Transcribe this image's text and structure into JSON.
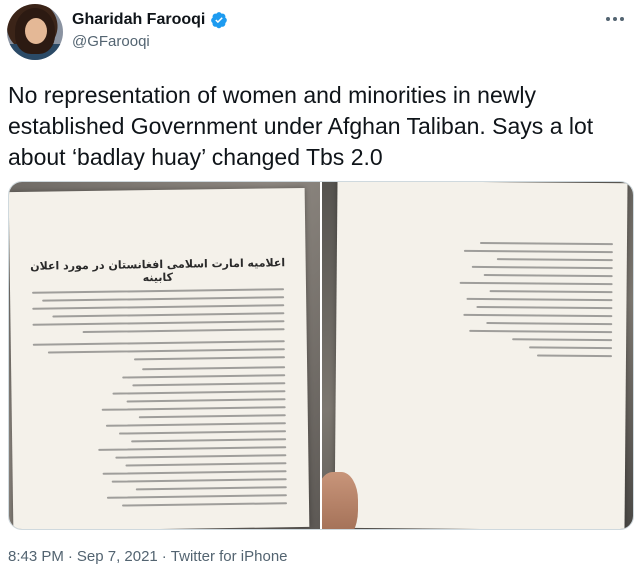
{
  "tweet": {
    "author": {
      "display_name": "Gharidah Farooqi",
      "handle": "@GFarooqi",
      "verified": true,
      "avatar_icon": "profile-photo"
    },
    "more_icon": "ellipsis-icon",
    "text": "No representation of women and minorities in newly established Government under Afghan Taliban. Says a lot about ‘badlay huay’ changed Tbs 2.0",
    "media": {
      "left_photo": {
        "document_title": "اعلامیه امارت اسلامی افغانستان در مورد اعلان کابینه"
      },
      "right_photo": {}
    },
    "time": "8:43 PM",
    "separator": "·",
    "date": "Sep 7, 2021",
    "source": "Twitter for iPhone"
  },
  "colors": {
    "text_primary": "#0f1419",
    "text_secondary": "#536471",
    "verified_blue": "#1d9bf0",
    "border": "#cfd9de"
  }
}
